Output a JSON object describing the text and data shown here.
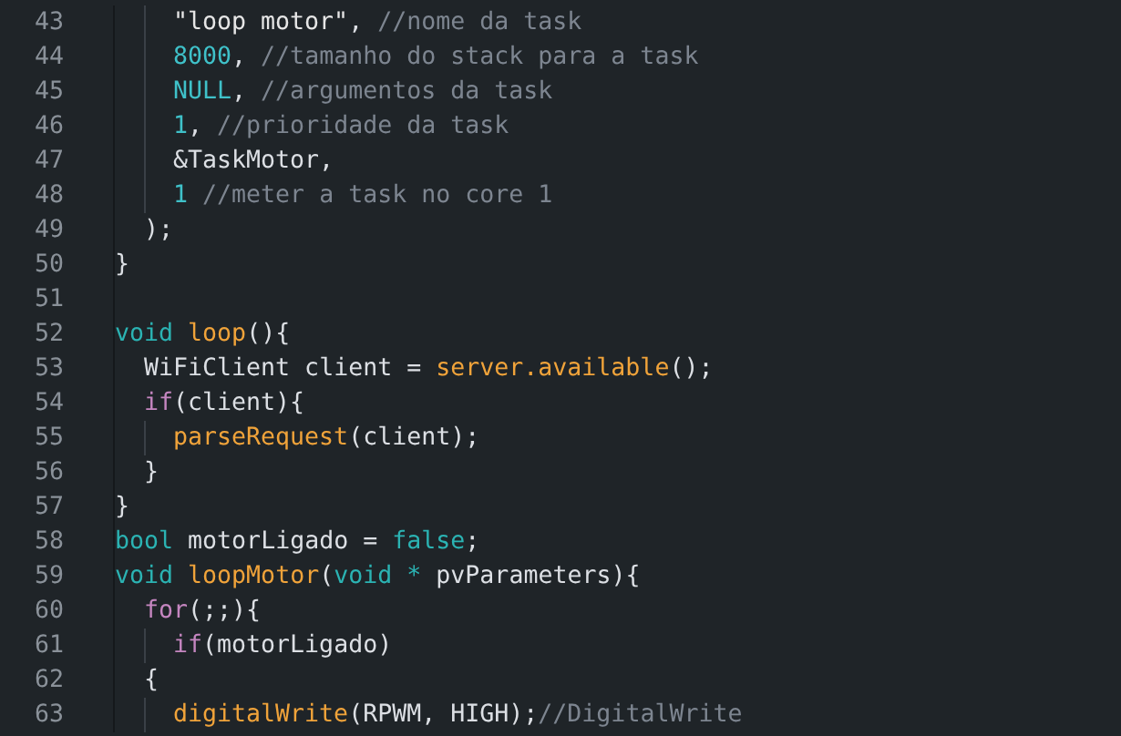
{
  "editor": {
    "lines": [
      {
        "number": "43",
        "tokens": [
          {
            "text": "    \"loop motor\"",
            "kind": "string"
          },
          {
            "text": ", "
          },
          {
            "text": "//nome da task",
            "kind": "comment"
          }
        ]
      },
      {
        "number": "44",
        "tokens": [
          {
            "text": "    8000",
            "kind": "number"
          },
          {
            "text": ", "
          },
          {
            "text": "//tamanho do stack para a task",
            "kind": "comment"
          }
        ]
      },
      {
        "number": "45",
        "tokens": [
          {
            "text": "    NULL",
            "kind": "number"
          },
          {
            "text": ", "
          },
          {
            "text": "//argumentos da task",
            "kind": "comment"
          }
        ]
      },
      {
        "number": "46",
        "tokens": [
          {
            "text": "    1",
            "kind": "number"
          },
          {
            "text": ", "
          },
          {
            "text": "//prioridade da task",
            "kind": "comment"
          }
        ]
      },
      {
        "number": "47",
        "tokens": [
          {
            "text": "    &TaskMotor,"
          }
        ]
      },
      {
        "number": "48",
        "tokens": [
          {
            "text": "    1",
            "kind": "number"
          },
          {
            "text": " //meter a task no core 1",
            "kind": "comment"
          }
        ]
      },
      {
        "number": "49",
        "tokens": [
          {
            "text": "  );"
          }
        ]
      },
      {
        "number": "50",
        "tokens": [
          {
            "text": "}"
          }
        ]
      },
      {
        "number": "51"
      },
      {
        "number": "52",
        "tokens": [
          {
            "text": "void ",
            "kind": "keyword"
          },
          {
            "text": "loop",
            "kind": "function"
          },
          {
            "text": "(){"
          }
        ]
      },
      {
        "number": "53",
        "tokens": [
          {
            "text": "  WiFiClient client = "
          },
          {
            "text": "server.available",
            "kind": "function"
          },
          {
            "text": "();"
          }
        ]
      },
      {
        "number": "54",
        "tokens": [
          {
            "text": "  if",
            "kind": "control"
          },
          {
            "text": "(client){"
          }
        ]
      },
      {
        "number": "55",
        "tokens": [
          {
            "text": "    parseRequest",
            "kind": "function"
          },
          {
            "text": "(client);"
          }
        ]
      },
      {
        "number": "56",
        "tokens": [
          {
            "text": "  }"
          }
        ]
      },
      {
        "number": "57",
        "tokens": [
          {
            "text": "}"
          }
        ]
      },
      {
        "number": "58",
        "tokens": [
          {
            "text": "bool",
            "kind": "keyword"
          },
          {
            "text": " motorLigado = "
          },
          {
            "text": "false",
            "kind": "keyword"
          },
          {
            "text": ";"
          }
        ]
      },
      {
        "number": "59",
        "tokens": [
          {
            "text": "void ",
            "kind": "keyword"
          },
          {
            "text": "loopMotor",
            "kind": "function"
          },
          {
            "text": "("
          },
          {
            "text": "void *",
            "kind": "keyword"
          },
          {
            "text": " pvParameters){"
          }
        ]
      },
      {
        "number": "60",
        "tokens": [
          {
            "text": "  for",
            "kind": "control"
          },
          {
            "text": "(;;){"
          }
        ]
      },
      {
        "number": "61",
        "tokens": [
          {
            "text": "    if",
            "kind": "control"
          },
          {
            "text": "(motorLigado)"
          }
        ]
      },
      {
        "number": "62",
        "tokens": [
          {
            "text": "  {"
          }
        ]
      },
      {
        "number": "63",
        "tokens": [
          {
            "text": "    digitalWrite",
            "kind": "function"
          },
          {
            "text": "(RPWM, HIGH);"
          },
          {
            "text": "//DigitalWrite",
            "kind": "comment"
          }
        ]
      }
    ]
  }
}
